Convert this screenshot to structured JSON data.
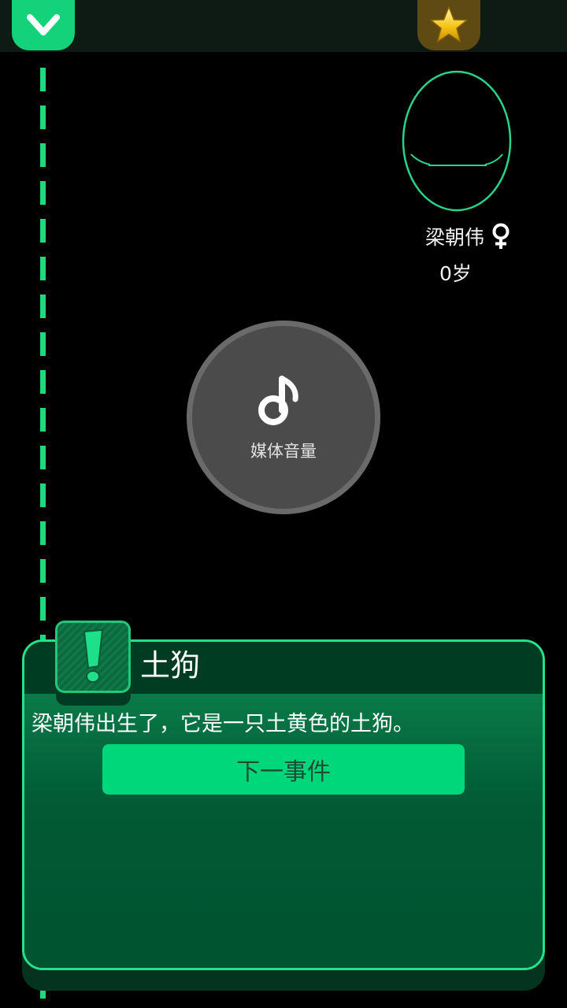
{
  "top_bar": {
    "collapse_icon": "chevron-down-icon",
    "star_icon": "star-icon",
    "accent": "#14d27a",
    "star_tab_color": "#5e4a12"
  },
  "character": {
    "name": "梁朝伟",
    "gender_icon": "female-symbol-icon",
    "age": "0岁"
  },
  "volume_overlay": {
    "icon": "music-note-icon",
    "label": "媒体音量"
  },
  "event": {
    "icon": "exclamation-icon",
    "title": "土狗",
    "text": "梁朝伟出生了，它是一只土黄色的土狗。",
    "next_button_label": "下一事件",
    "button_color": "#00d67a"
  }
}
